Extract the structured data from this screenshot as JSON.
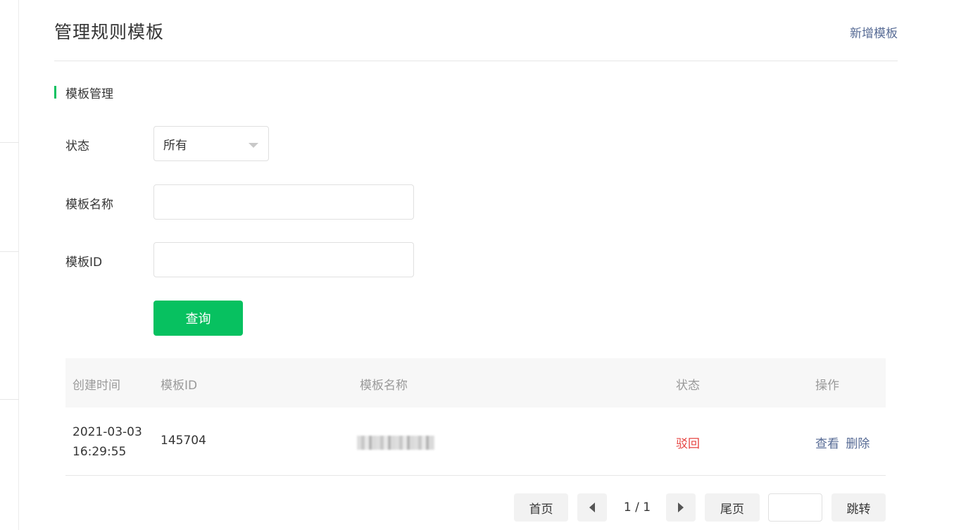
{
  "header": {
    "title": "管理规则模板",
    "add_link": "新增模板"
  },
  "section": {
    "title": "模板管理"
  },
  "form": {
    "status_label": "状态",
    "status_value": "所有",
    "name_label": "模板名称",
    "name_value": "",
    "id_label": "模板ID",
    "id_value": "",
    "query_button": "查询"
  },
  "table": {
    "columns": [
      "创建时间",
      "模板ID",
      "模板名称",
      "状态",
      "操作"
    ],
    "rows": [
      {
        "created": "2021-03-03 16:29:55",
        "template_id": "145704",
        "status": "驳回",
        "actions": [
          "查看",
          "删除"
        ]
      }
    ]
  },
  "pagination": {
    "first": "首页",
    "page_indicator": "1 / 1",
    "last": "尾页",
    "jump_value": "",
    "jump": "跳转"
  },
  "colors": {
    "accent": "#07c160",
    "link": "#576b95",
    "danger": "#e64340"
  }
}
